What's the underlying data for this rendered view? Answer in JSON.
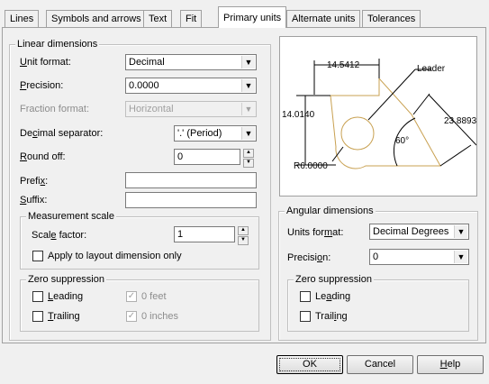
{
  "tabs": [
    {
      "label": "Lines"
    },
    {
      "label": "Symbols and arrows"
    },
    {
      "label": "Text"
    },
    {
      "label": "Fit"
    },
    {
      "label": "Primary units"
    },
    {
      "label": "Alternate units"
    },
    {
      "label": "Tolerances"
    }
  ],
  "linear": {
    "title": "Linear dimensions",
    "unit_format": {
      "label_pre": "",
      "label_key": "U",
      "label_post": "nit format:",
      "value": "Decimal"
    },
    "precision": {
      "label_pre": "",
      "label_key": "P",
      "label_post": "recision:",
      "value": "0.0000"
    },
    "fraction_format": {
      "label": "Fraction format:",
      "value": "Horizontal"
    },
    "decimal_separator": {
      "label_pre": "De",
      "label_key": "c",
      "label_post": "imal separator:",
      "value": "'.' (Period)"
    },
    "round_off": {
      "label_pre": "",
      "label_key": "R",
      "label_post": "ound off:",
      "value": "0"
    },
    "prefix": {
      "label_pre": "Prefi",
      "label_key": "x",
      "label_post": ":",
      "value": ""
    },
    "suffix": {
      "label_pre": "",
      "label_key": "S",
      "label_post": "uffix:",
      "value": ""
    },
    "measurement_scale": {
      "title": "Measurement scale",
      "scale_factor": {
        "label_pre": "Scal",
        "label_key": "e",
        "label_post": " factor:",
        "value": "1"
      },
      "layout_only": {
        "label": "Apply to layout dimension only",
        "checked": false
      }
    },
    "zero_suppression": {
      "title": "Zero suppression",
      "leading": {
        "label_pre": "",
        "label_key": "L",
        "label_post": "eading",
        "checked": false
      },
      "trailing": {
        "label_pre": "",
        "label_key": "T",
        "label_post": "railing",
        "checked": false
      },
      "feet": {
        "label": "0 feet",
        "checked": true
      },
      "inches": {
        "label": "0 inches",
        "checked": true
      }
    }
  },
  "preview": {
    "dim_top": "14.5412",
    "dim_left": "14.0140",
    "dim_diag": "23.8893",
    "angle": "60°",
    "radius": "R6.0000",
    "leader": "Leader"
  },
  "angular": {
    "title": "Angular dimensions",
    "units_format": {
      "label_pre": "Units for",
      "label_key": "m",
      "label_post": "at:",
      "value": "Decimal Degrees"
    },
    "precision": {
      "label_pre": "Precisi",
      "label_key": "o",
      "label_post": "n:",
      "value": "0"
    },
    "zero_suppression": {
      "title": "Zero suppression",
      "leading": {
        "label_pre": "Le",
        "label_key": "a",
        "label_post": "ding",
        "checked": false
      },
      "trailing": {
        "label_pre": "Trail",
        "label_key": "i",
        "label_post": "ng",
        "checked": false
      }
    }
  },
  "buttons": {
    "ok": "OK",
    "cancel": "Cancel",
    "help_pre": "",
    "help_key": "H",
    "help_post": "elp"
  }
}
